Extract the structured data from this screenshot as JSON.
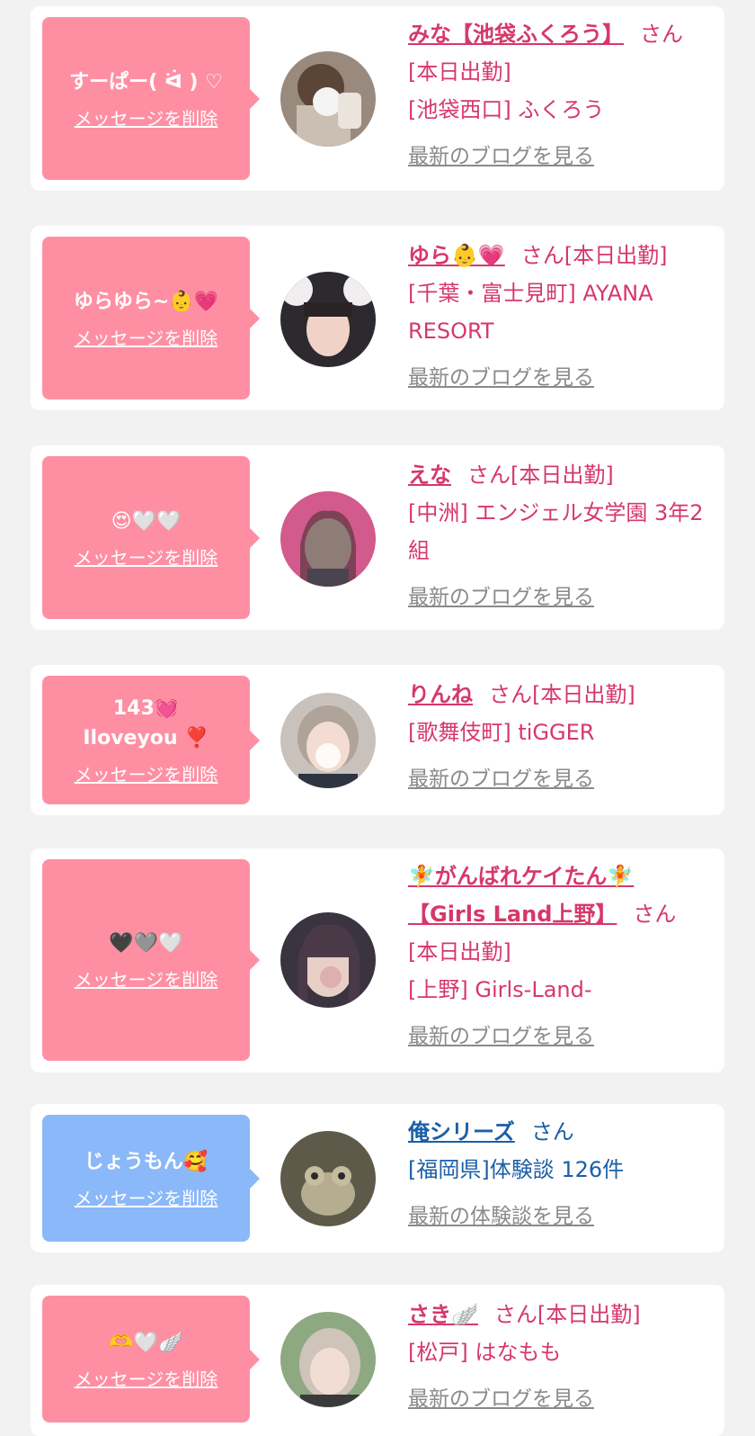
{
  "delete_label": "メッセージを削除",
  "colors": {
    "pink_bubble": "#fe8fa3",
    "blue_bubble": "#8ab8f8",
    "cast_text": "#d6386a",
    "user_text": "#1a5fa8",
    "link_gray": "#8a8a8a"
  },
  "items": [
    {
      "message": "すーぱー( ᐛ ) ♡",
      "name": "みな【池袋ふくろう】",
      "honorific": "さん",
      "status": "[本日出勤]",
      "shop": "[池袋西口] ふくろう",
      "blog_link": "最新のブログを見る",
      "avatar_icon": "profile-photo"
    },
    {
      "message": "ゆらゆら~👶💗",
      "name": "ゆら👶💗",
      "honorific": "さん",
      "status": "[本日出勤]",
      "shop": "[千葉・富士見町] AYANA RESORT",
      "blog_link": "最新のブログを見る",
      "avatar_icon": "profile-photo"
    },
    {
      "message": "😍🤍🤍",
      "name": "えな",
      "honorific": "さん",
      "status": "[本日出勤]",
      "shop": "[中洲] エンジェル女学園 3年2組",
      "blog_link": "最新のブログを見る",
      "avatar_icon": "profile-photo"
    },
    {
      "message": "143💓\nIloveyou ❣️",
      "name": "りんね",
      "honorific": "さん",
      "status": "[本日出勤]",
      "shop": "[歌舞伎町] tiGGER",
      "blog_link": "最新のブログを見る",
      "avatar_icon": "profile-photo"
    },
    {
      "message": "🖤🩶🤍",
      "name": "🧚がんばれケイたん🧚【Girls Land上野】",
      "honorific": "さん",
      "status": "[本日出勤]",
      "shop": "[上野] Girls-Land-",
      "blog_link": "最新のブログを見る",
      "avatar_icon": "profile-photo"
    },
    {
      "message": "じょうもん🥰",
      "name": "俺シリーズ",
      "honorific": "さん",
      "status": "",
      "shop": "[福岡県]体験談 126件",
      "blog_link": "最新の体験談を見る",
      "avatar_icon": "frog-photo"
    },
    {
      "message": "🫶🤍🪽",
      "name": "さき🪽",
      "honorific": "さん",
      "status": "[本日出勤]",
      "shop": "[松戸] はなもも",
      "blog_link": "最新のブログを見る",
      "avatar_icon": "profile-photo"
    }
  ]
}
